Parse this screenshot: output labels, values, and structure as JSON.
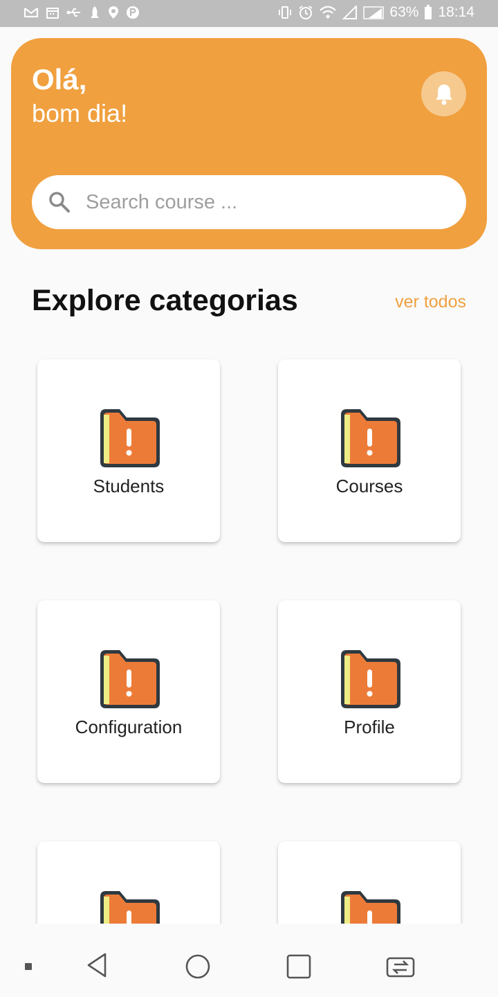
{
  "status_bar": {
    "battery": "63%",
    "time": "18:14",
    "left_icons": [
      "gmail-icon",
      "calendar-icon",
      "usb-icon",
      "rocket-icon",
      "location-icon",
      "parking-icon"
    ],
    "right_icons": [
      "vibrate-icon",
      "alarm-icon",
      "wifi-icon",
      "signal-icon",
      "signal-icon",
      "battery-icon"
    ]
  },
  "header": {
    "greeting": "Olá,",
    "subgreeting": "bom dia!",
    "bell_icon": "bell-icon",
    "accent_color": "#f0a03f"
  },
  "search": {
    "placeholder": "Search course ...",
    "value": ""
  },
  "section": {
    "title": "Explore categorias",
    "see_all": "ver todos"
  },
  "categories": [
    {
      "label": "Students",
      "icon": "folder-alert-icon"
    },
    {
      "label": "Courses",
      "icon": "folder-alert-icon"
    },
    {
      "label": "Configuration",
      "icon": "folder-alert-icon"
    },
    {
      "label": "Profile",
      "icon": "folder-alert-icon"
    },
    {
      "label": "",
      "icon": "folder-alert-icon"
    },
    {
      "label": "",
      "icon": "folder-alert-icon"
    }
  ],
  "nav_bar": {
    "icons": [
      "dot-icon",
      "back-icon",
      "home-icon",
      "recents-icon",
      "switch-app-icon"
    ]
  }
}
